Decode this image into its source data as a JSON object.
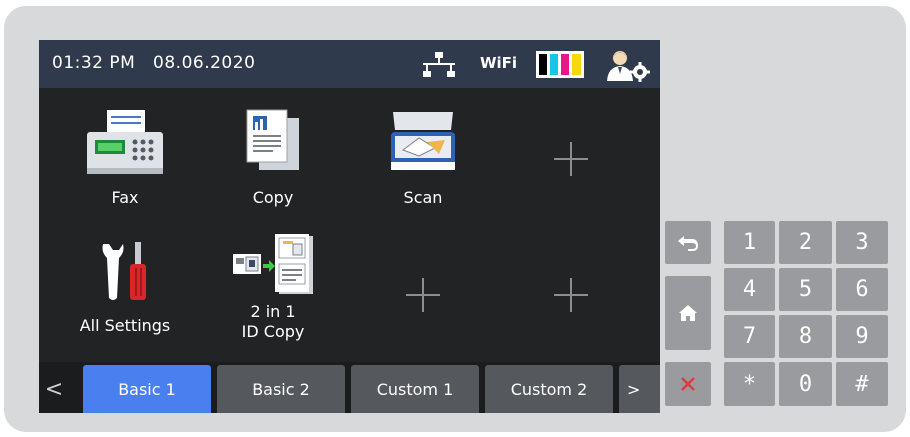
{
  "status": {
    "time": "01:32 PM",
    "date": "08.06.2020",
    "wifi_label": "WiFi",
    "icons": [
      "wired-network-icon",
      "ink-levels-icon",
      "admin-settings-icon"
    ],
    "ink_colors": [
      "#000000",
      "#17c5e8",
      "#e8178a",
      "#f5d90a"
    ]
  },
  "tiles": [
    {
      "label": "Fax",
      "icon": "fax-icon"
    },
    {
      "label": "Copy",
      "icon": "copy-icon"
    },
    {
      "label": "Scan",
      "icon": "scan-icon"
    },
    {
      "label": "",
      "icon": "add-shortcut-icon"
    },
    {
      "label": "All Settings",
      "icon": "settings-tools-icon"
    },
    {
      "label_line1": "2 in 1",
      "label_line2": "ID Copy",
      "icon": "id-copy-icon"
    },
    {
      "label": "",
      "icon": "add-shortcut-icon"
    },
    {
      "label": "",
      "icon": "add-shortcut-icon"
    }
  ],
  "tabs": {
    "prev_glyph": "<",
    "next_glyph": ">",
    "items": [
      {
        "label": "Basic 1",
        "active": true
      },
      {
        "label": "Basic 2",
        "active": false
      },
      {
        "label": "Custom 1",
        "active": false
      },
      {
        "label": "Custom 2",
        "active": false
      }
    ]
  },
  "side_buttons": [
    "back-icon",
    "home-icon",
    "stop-icon"
  ],
  "keypad": {
    "keys": [
      "1",
      "2",
      "3",
      "4",
      "5",
      "6",
      "7",
      "8",
      "9",
      "*",
      "0",
      "#"
    ]
  },
  "colors": {
    "active_tab": "#4a7ff0",
    "status_bar": "#2f3a4c",
    "screen": "#222325",
    "stop": "#e23b3b"
  }
}
